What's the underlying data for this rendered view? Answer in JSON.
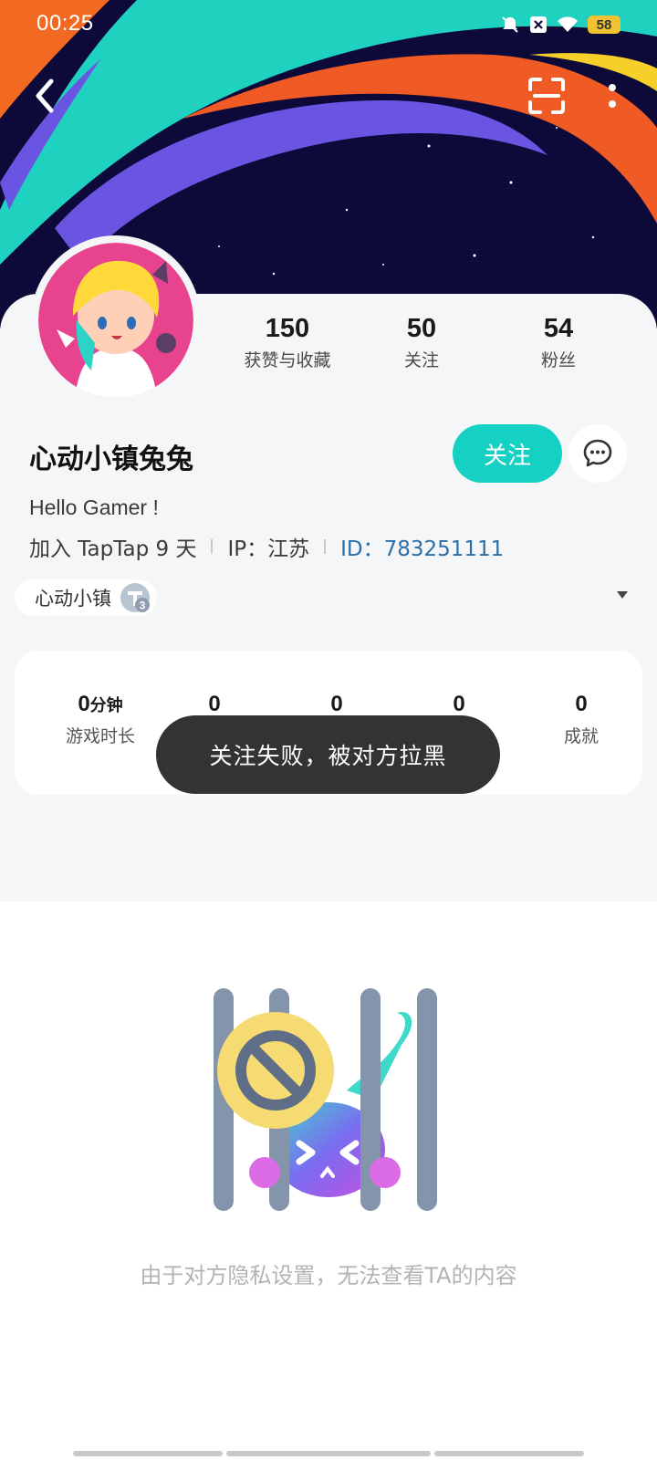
{
  "status_bar": {
    "time": "00:25",
    "battery": "58",
    "icons": [
      "mute-icon",
      "close-notify-icon",
      "wifi-icon",
      "battery-icon"
    ]
  },
  "header": {
    "back_icon": "chevron-left-icon",
    "scan_icon": "scan-icon",
    "more_icon": "more-vertical-icon"
  },
  "profile": {
    "name": "心动小镇兔兔",
    "bio": "Hello Gamer !",
    "joined": "加入 TapTap 9 天",
    "ip": "IP：江苏",
    "id": "ID：783251111",
    "follow_label": "关注",
    "town_label": "心动小镇",
    "level": "3"
  },
  "stats": [
    {
      "value": "150",
      "label": "获赞与收藏"
    },
    {
      "value": "50",
      "label": "关注"
    },
    {
      "value": "54",
      "label": "粉丝"
    }
  ],
  "game_stats": {
    "playtime_value": "0",
    "playtime_unit": "分钟",
    "playtime_label": "游戏时长",
    "v2": "0",
    "v3": "0",
    "v4": "0",
    "achievements_value": "0",
    "achievements_label": "成就"
  },
  "toast": "关注失败，被对方拉黑",
  "privacy_message": "由于对方隐私设置，无法查看TA的内容",
  "colors": {
    "accent": "#15d1c3",
    "id_link": "#2a6fa8",
    "banner_bg": "#0d0a3a",
    "toast_bg": "#333333"
  }
}
